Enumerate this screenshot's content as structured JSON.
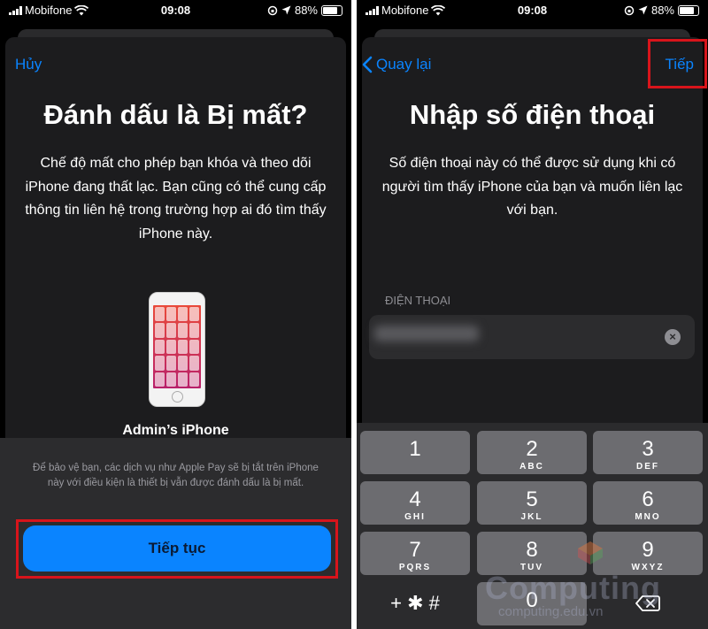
{
  "left_screen": {
    "status": {
      "carrier": "Mobifone",
      "time": "09:08",
      "battery": "88%"
    },
    "cancel_label": "Hủy",
    "title": "Đánh dấu là Bị mất?",
    "description": "Chế độ mất cho phép bạn khóa và theo dõi iPhone đang thất lạc. Bạn cũng có thể cung cấp thông tin liên hệ trong trường hợp ai đó tìm thấy iPhone này.",
    "device_name": "Admin’s iPhone",
    "footnote": "Để bảo vệ bạn, các dịch vụ như Apple Pay sẽ bị tắt trên iPhone này với điều kiện là thiết bị vẫn được đánh dấu là bị mất.",
    "continue_label": "Tiếp tục"
  },
  "right_screen": {
    "status": {
      "carrier": "Mobifone",
      "time": "09:08",
      "battery": "88%"
    },
    "back_label": "Quay lại",
    "next_label": "Tiếp",
    "title": "Nhập số điện thoại",
    "description": "Số điện thoại này có thể được sử dụng khi có người tìm thấy iPhone của bạn và muốn liên lạc với bạn.",
    "field_label": "ĐIỆN THOẠI",
    "keypad": [
      {
        "num": "1",
        "letters": ""
      },
      {
        "num": "2",
        "letters": "ABC"
      },
      {
        "num": "3",
        "letters": "DEF"
      },
      {
        "num": "4",
        "letters": "GHI"
      },
      {
        "num": "5",
        "letters": "JKL"
      },
      {
        "num": "6",
        "letters": "MNO"
      },
      {
        "num": "7",
        "letters": "PQRS"
      },
      {
        "num": "8",
        "letters": "TUV"
      },
      {
        "num": "9",
        "letters": "WXYZ"
      },
      {
        "num": "+ ✱ #",
        "letters": ""
      },
      {
        "num": "0",
        "letters": ""
      }
    ]
  },
  "watermark": {
    "brand": "Computing",
    "site": "computing.edu.vn"
  },
  "colors": {
    "accent": "#0a84ff",
    "highlight": "#d8141b",
    "sheet": "#1c1c1e"
  },
  "icons": [
    "wifi-icon",
    "signal-icon",
    "location-icon",
    "battery-icon",
    "back-chevron-icon",
    "clear-icon",
    "backspace-icon"
  ]
}
